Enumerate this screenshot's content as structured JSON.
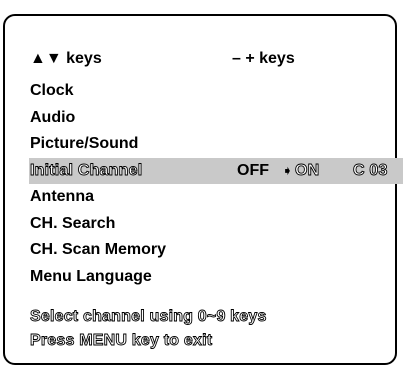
{
  "header": {
    "nav_keys": "▲▼ keys",
    "adjust_keys": "– + keys"
  },
  "menu": {
    "items": [
      "Clock",
      "Audio",
      "Picture/Sound",
      "Initial Channel",
      "Antenna",
      "CH. Search",
      "CH. Scan Memory",
      "Menu Language"
    ],
    "selected_index": 3,
    "initial_channel": {
      "off_label": "OFF",
      "arrow_glyph": "➧",
      "on_label": "ON",
      "channel": "C 03"
    }
  },
  "footer": {
    "line1": "Select channel using 0~9 keys",
    "line2": "Press MENU key to exit"
  }
}
